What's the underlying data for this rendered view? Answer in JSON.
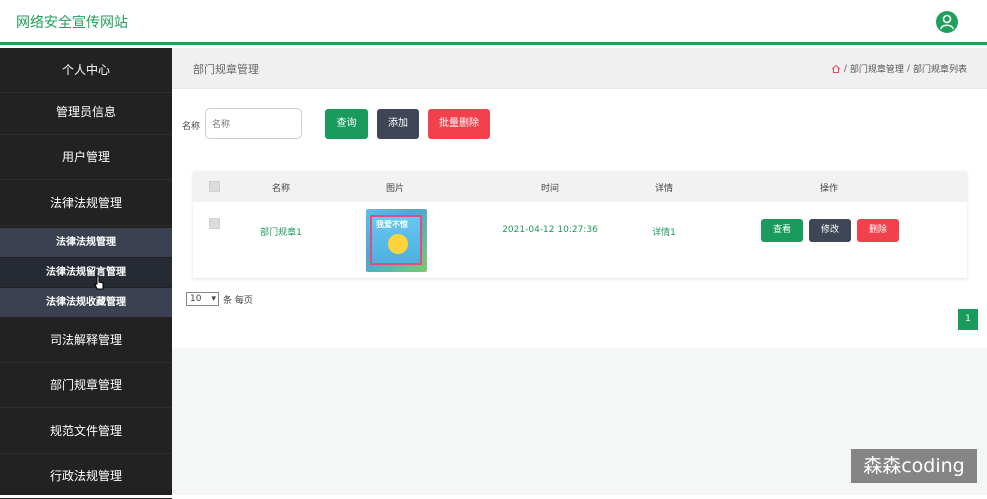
{
  "app": {
    "title": "网络安全宣传网站"
  },
  "sidebar": {
    "items": [
      {
        "label": "个人中心"
      },
      {
        "label": "管理员信息"
      },
      {
        "label": "用户管理"
      },
      {
        "label": "法律法规管理"
      },
      {
        "label": "司法解释管理"
      },
      {
        "label": "部门规章管理"
      },
      {
        "label": "规范文件管理"
      },
      {
        "label": "行政法规管理"
      }
    ],
    "subitems": [
      {
        "label": "法律法规管理"
      },
      {
        "label": "法律法规留言管理"
      },
      {
        "label": "法律法规收藏管理"
      }
    ]
  },
  "header_bar": {
    "page_title": "部门规章管理",
    "breadcrumb": {
      "sep": "/",
      "level1": "部门规章管理",
      "level2": "部门规章列表"
    }
  },
  "search": {
    "label": "名称",
    "placeholder": "名称"
  },
  "toolbar": {
    "query_label": "查询",
    "add_label": "添加",
    "batch_delete_label": "批量删除"
  },
  "table": {
    "columns": [
      "名称",
      "图片",
      "时间",
      "详情",
      "操作"
    ],
    "rows": [
      {
        "name": "部门规章1",
        "image_title": "我爱不惊",
        "time": "2021-04-12 10:27:36",
        "detail": "详情1",
        "actions": {
          "view": "查看",
          "edit": "修改",
          "delete": "删除"
        }
      }
    ]
  },
  "pagination": {
    "page_size": "10",
    "page_size_suffix": "条 每页",
    "current_page": "1"
  },
  "watermark": {
    "text": "森森coding"
  },
  "colors": {
    "accent": "#1a9a5c",
    "dark_button": "#3f4657",
    "danger": "#f2414c",
    "sidebar_bg": "#222222"
  }
}
